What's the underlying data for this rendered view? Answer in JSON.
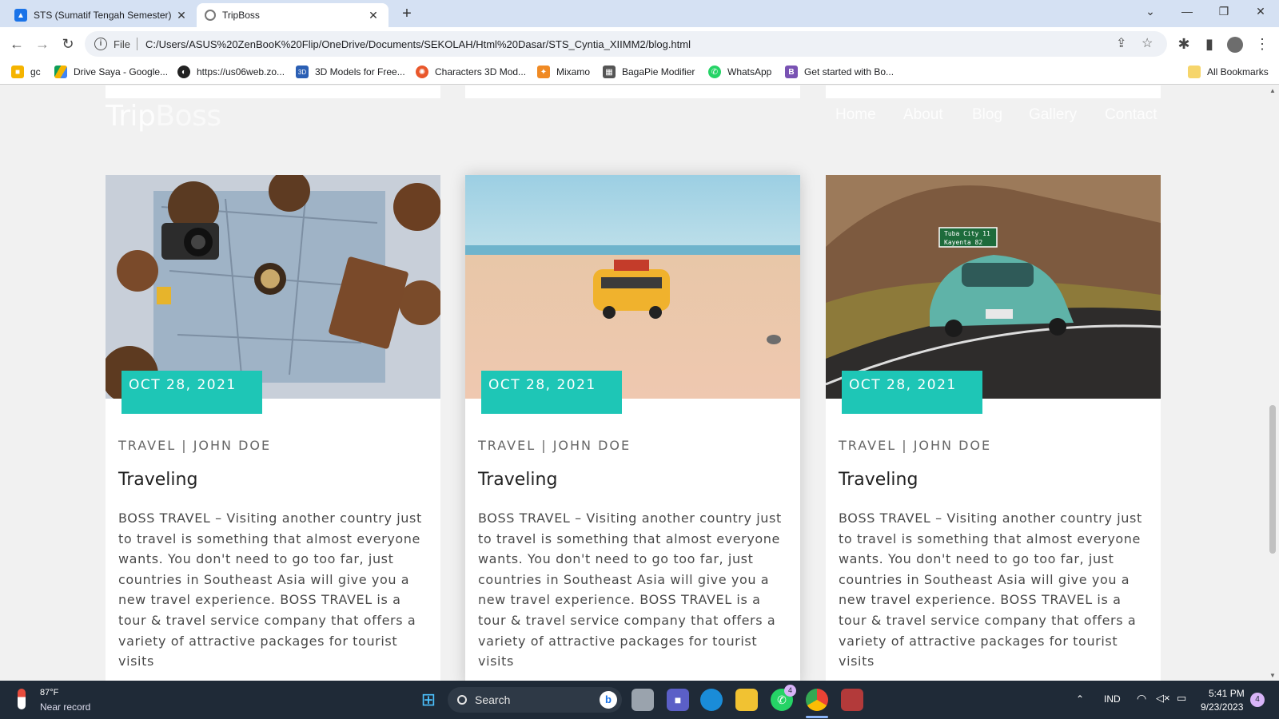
{
  "browser": {
    "tabs": [
      {
        "title": "STS (Sumatif Tengah Semester) C",
        "active": false
      },
      {
        "title": "TripBoss",
        "active": true
      }
    ],
    "new_tab": "+",
    "address": {
      "scheme_label": "File",
      "url": "C:/Users/ASUS%20ZenBooK%20Flip/OneDrive/Documents/SEKOLAH/Html%20Dasar/STS_Cyntia_XIIMM2/blog.html"
    },
    "bookmarks": [
      {
        "label": "gc",
        "icon": "classroom-icon"
      },
      {
        "label": "Drive Saya - Google...",
        "icon": "drive-icon"
      },
      {
        "label": "https://us06web.zo...",
        "icon": "zoom-icon"
      },
      {
        "label": "3D Models for Free...",
        "icon": "3d-icon"
      },
      {
        "label": "Characters 3D Mod...",
        "icon": "characters-icon"
      },
      {
        "label": "Mixamo",
        "icon": "mixamo-icon"
      },
      {
        "label": "BagaPie Modifier",
        "icon": "bagapie-icon"
      },
      {
        "label": "WhatsApp",
        "icon": "whatsapp-icon"
      },
      {
        "label": "Get started with Bo...",
        "icon": "bootstrap-icon"
      }
    ],
    "all_bookmarks": "All Bookmarks"
  },
  "site": {
    "logo_part1": "Trip",
    "logo_part2": "Boss",
    "nav": [
      "Home",
      "About",
      "Blog",
      "Gallery",
      "Contact"
    ],
    "accent_color": "#1ec6b6",
    "posts": [
      {
        "image": "travel-map-camera-photo",
        "date": "OCT 28, 2021",
        "meta": "TRAVEL | JOHN DOE",
        "title": "Traveling",
        "body": "BOSS TRAVEL – Visiting another country just to travel is something that almost everyone wants. You don't need to go too far, just countries in Southeast Asia will give you a new travel experience. BOSS TRAVEL is a tour & travel service company that offers a variety of attractive packages for tourist visits"
      },
      {
        "image": "toy-van-on-beach-photo",
        "date": "OCT 28, 2021",
        "meta": "TRAVEL | JOHN DOE",
        "title": "Traveling",
        "body": "BOSS TRAVEL – Visiting another country just to travel is something that almost everyone wants. You don't need to go too far, just countries in Southeast Asia will give you a new travel experience. BOSS TRAVEL is a tour & travel service company that offers a variety of attractive packages for tourist visits"
      },
      {
        "image": "vintage-car-desert-road-photo",
        "date": "OCT 28, 2021",
        "meta": "TRAVEL | JOHN DOE",
        "title": "Traveling",
        "body": "BOSS TRAVEL – Visiting another country just to travel is something that almost everyone wants. You don't need to go too far, just countries in Southeast Asia will give you a new travel experience. BOSS TRAVEL is a tour & travel service company that offers a variety of attractive packages for tourist visits"
      }
    ],
    "road_sign": {
      "line1": "Tuba City  11",
      "line2": "Kayenta  82"
    }
  },
  "taskbar": {
    "weather_temp": "87°F",
    "weather_desc": "Near record",
    "search_placeholder": "Search",
    "whatsapp_badge": "4",
    "language": "IND",
    "time": "5:41 PM",
    "date": "9/23/2023",
    "notifications": "4"
  }
}
